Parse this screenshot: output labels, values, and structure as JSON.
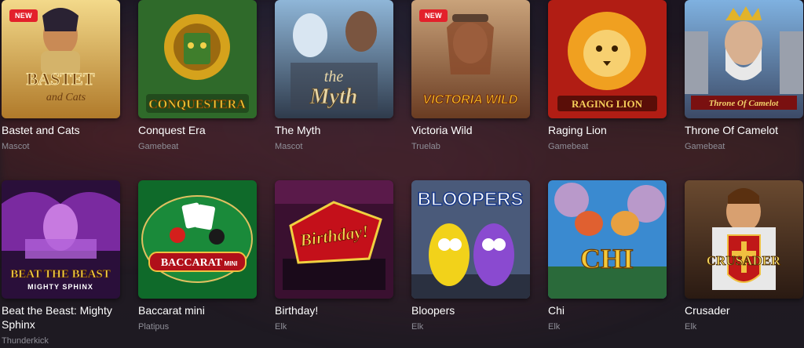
{
  "badges": {
    "new": "NEW"
  },
  "games": [
    {
      "title": "Bastet and Cats",
      "provider": "Mascot",
      "logo": "BASTET",
      "logo2": "and Cats",
      "is_new": true
    },
    {
      "title": "Conquest Era",
      "provider": "Gamebeat",
      "logo": "CONQUESTERA",
      "is_new": false
    },
    {
      "title": "The Myth",
      "provider": "Mascot",
      "logo": "the",
      "logo2": "Myth",
      "is_new": false
    },
    {
      "title": "Victoria Wild",
      "provider": "Truelab",
      "logo": "VICTORIA WILD",
      "is_new": true
    },
    {
      "title": "Raging Lion",
      "provider": "Gamebeat",
      "logo": "RAGING LION",
      "is_new": false
    },
    {
      "title": "Throne Of Camelot",
      "provider": "Gamebeat",
      "logo": "Throne Of Camelot",
      "is_new": false
    },
    {
      "title": "Beat the Beast: Mighty Sphinx",
      "provider": "Thunderkick",
      "logo": "BEAT THE BEAST",
      "logo2": "MIGHTY SPHINX",
      "is_new": false
    },
    {
      "title": "Baccarat mini",
      "provider": "Platipus",
      "logo": "BACCARAT",
      "logo2": "MINI",
      "is_new": false
    },
    {
      "title": "Birthday!",
      "provider": "Elk",
      "logo": "Birthday!",
      "is_new": false
    },
    {
      "title": "Bloopers",
      "provider": "Elk",
      "logo": "BLOOPERS",
      "is_new": false
    },
    {
      "title": "Chi",
      "provider": "Elk",
      "logo": "CHI",
      "is_new": false
    },
    {
      "title": "Crusader",
      "provider": "Elk",
      "logo": "CRUSADER",
      "is_new": false
    }
  ]
}
